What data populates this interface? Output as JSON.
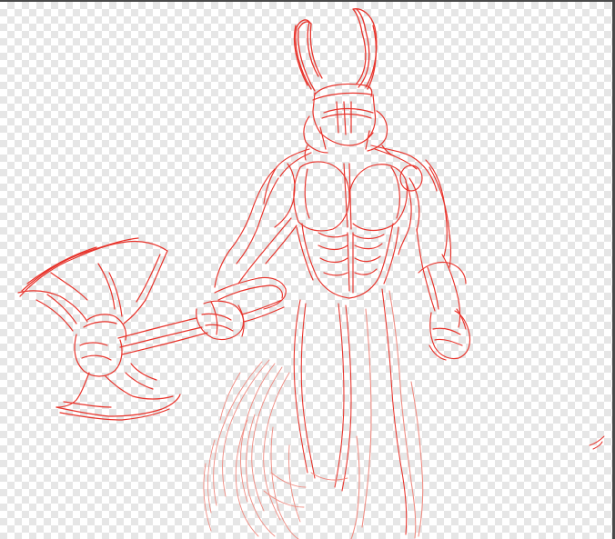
{
  "canvas": {
    "background": "transparent-checkerboard",
    "checker_color": "#e6e6e6"
  },
  "sketch": {
    "subject": "horned-warrior-with-axe",
    "stroke_color": "#e8322a",
    "stroke_color_light": "#f08a80"
  }
}
